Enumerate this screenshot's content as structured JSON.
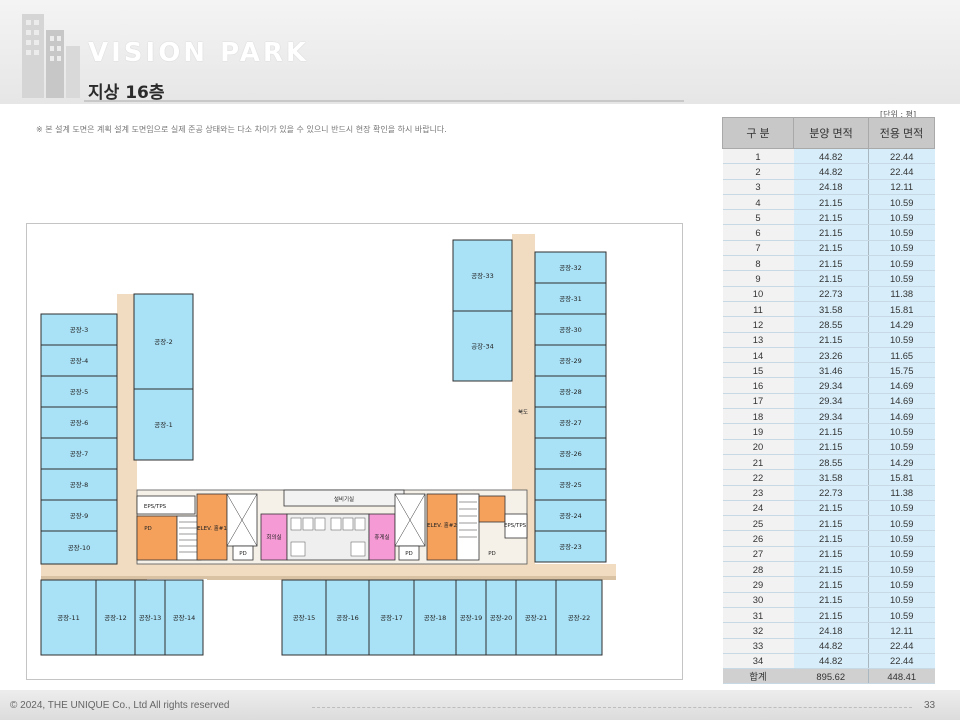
{
  "brand": "VISION PARK",
  "floor_title": "지상 16층",
  "note": "※ 본 설계 도면은 계획 설계 도면임으로 실제 준공 상태와는 다소 차이가 있을 수 있으니 반드시 현장 확인을 하시 바랍니다.",
  "unit_label": "[단위 : 평]",
  "table": {
    "headers": [
      "구 분",
      "분양 면적",
      "전용 면적"
    ],
    "rows": [
      [
        "1",
        "44.82",
        "22.44"
      ],
      [
        "2",
        "44.82",
        "22.44"
      ],
      [
        "3",
        "24.18",
        "12.11"
      ],
      [
        "4",
        "21.15",
        "10.59"
      ],
      [
        "5",
        "21.15",
        "10.59"
      ],
      [
        "6",
        "21.15",
        "10.59"
      ],
      [
        "7",
        "21.15",
        "10.59"
      ],
      [
        "8",
        "21.15",
        "10.59"
      ],
      [
        "9",
        "21.15",
        "10.59"
      ],
      [
        "10",
        "22.73",
        "11.38"
      ],
      [
        "11",
        "31.58",
        "15.81"
      ],
      [
        "12",
        "28.55",
        "14.29"
      ],
      [
        "13",
        "21.15",
        "10.59"
      ],
      [
        "14",
        "23.26",
        "11.65"
      ],
      [
        "15",
        "31.46",
        "15.75"
      ],
      [
        "16",
        "29.34",
        "14.69"
      ],
      [
        "17",
        "29.34",
        "14.69"
      ],
      [
        "18",
        "29.34",
        "14.69"
      ],
      [
        "19",
        "21.15",
        "10.59"
      ],
      [
        "20",
        "21.15",
        "10.59"
      ],
      [
        "21",
        "28.55",
        "14.29"
      ],
      [
        "22",
        "31.58",
        "15.81"
      ],
      [
        "23",
        "22.73",
        "11.38"
      ],
      [
        "24",
        "21.15",
        "10.59"
      ],
      [
        "25",
        "21.15",
        "10.59"
      ],
      [
        "26",
        "21.15",
        "10.59"
      ],
      [
        "27",
        "21.15",
        "10.59"
      ],
      [
        "28",
        "21.15",
        "10.59"
      ],
      [
        "29",
        "21.15",
        "10.59"
      ],
      [
        "30",
        "21.15",
        "10.59"
      ],
      [
        "31",
        "21.15",
        "10.59"
      ],
      [
        "32",
        "24.18",
        "12.11"
      ],
      [
        "33",
        "44.82",
        "22.44"
      ],
      [
        "34",
        "44.82",
        "22.44"
      ]
    ],
    "total": [
      "합계",
      "895.62",
      "448.41"
    ]
  },
  "plan": {
    "units": [
      "공장-1",
      "공장-2",
      "공장-3",
      "공장-4",
      "공장-5",
      "공장-6",
      "공장-7",
      "공장-8",
      "공장-9",
      "공장-10",
      "공장-11",
      "공장-12",
      "공장-13",
      "공장-14",
      "공장-15",
      "공장-16",
      "공장-17",
      "공장-18",
      "공장-19",
      "공장-20",
      "공장-21",
      "공장-22",
      "공장-23",
      "공장-24",
      "공장-25",
      "공장-26",
      "공장-27",
      "공장-28",
      "공장-29",
      "공장-30",
      "공장-31",
      "공장-32",
      "공장-33",
      "공장-34"
    ],
    "rooms": {
      "elev1": "ELEV. 홀#1",
      "elev2": "ELEV. 홀#2",
      "meeting": "회의실",
      "lounge": "휴게실",
      "duct_room": "설비기실",
      "eps1": "EPS/TPS",
      "eps2": "EPS/TPS",
      "pd1": "PD",
      "pd2": "PD",
      "pd3": "PD",
      "pd4": "PD",
      "balcony": "북도"
    }
  },
  "footer": {
    "copyright": "© 2024, THE UNIQUE Co., Ltd  All rights reserved",
    "page": "33"
  },
  "colors": {
    "unit_fill": "#a9e1f6",
    "unit_stroke": "#2f2f2f",
    "corridor": "#f1dcc2",
    "elev": "#f5a15c",
    "pink": "#f59ad4",
    "table_value_bg": "#d7eefa"
  }
}
